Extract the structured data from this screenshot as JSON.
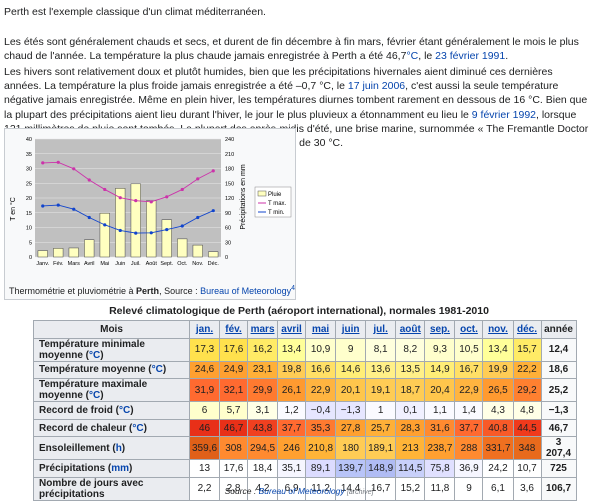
{
  "intro": {
    "p1": "Perth est l'exemple classique d'un climat méditerranéen.",
    "p2_a": "Les étés sont généralement chauds et secs, et durent de fin décembre à fin mars, février étant généralement le mois le plus chaud de l'année. La température la plus chaude jamais enregistrée à Perth a été 46,7",
    "p2_unit": "°C",
    "p2_b": ", le ",
    "p2_date": "23 février 1991",
    "p2_end": ".",
    "p3_a": "Les hivers sont relativement doux et plutôt humides, bien que les précipitations hivernales aient diminué ces dernières années. La température la plus froide jamais enregistrée a été –0,7 °C, le ",
    "p3_date1": "17 juin 2006",
    "p3_b": ", c'est aussi la seule température négative jamais enregistrée. Même en plein hiver, les températures diurnes tombent rarement en dessous de 16 °C. Bien que la plupart des précipitations aient lieu durant l'hiver, le jour le plus pluvieux a étonnamment eu lieu le ",
    "p3_date2": "9 février 1992",
    "p3_c": ", lorsque 121 millimètres de pluie sont tombés. La plupart des après-midis d'été, une brise marine, surnommée « The Fremantle Doctor », souffle du sud-ouest, refroidissant la ville parfois en dessous de 30 °C."
  },
  "chart_data": {
    "type": "bar",
    "categories": [
      "Janv.",
      "Fév.",
      "Mars",
      "Avril",
      "Mai",
      "Juin",
      "Juil.",
      "Août",
      "Sept.",
      "Oct.",
      "Nov.",
      "Déc."
    ],
    "ylabel_left": "T en °C",
    "ylabel_right": "Précipitations en mm",
    "ylim_left": [
      0,
      40
    ],
    "ylim_right": [
      0,
      240
    ],
    "yticks_left": [
      "0",
      "5",
      "10",
      "15",
      "20",
      "25",
      "30",
      "35",
      "40"
    ],
    "yticks_right": [
      "0",
      "30",
      "60",
      "90",
      "120",
      "150",
      "180",
      "210",
      "240"
    ],
    "legend": [
      "Pluie",
      "T max.",
      "T min."
    ],
    "legend_position": "right",
    "series": [
      {
        "name": "Pluie",
        "axis": "right",
        "kind": "bar",
        "color": "#ffffc0",
        "values": [
          13,
          17.6,
          18.4,
          35.1,
          89.1,
          139.7,
          148.9,
          114.5,
          75.8,
          36.9,
          24.2,
          10.7
        ]
      },
      {
        "name": "T max.",
        "axis": "left",
        "kind": "line",
        "color": "#cc33aa",
        "values": [
          31.9,
          32.1,
          29.9,
          26.1,
          22.9,
          20.1,
          19.1,
          18.7,
          20.4,
          22.9,
          26.5,
          29.2
        ]
      },
      {
        "name": "T min.",
        "axis": "left",
        "kind": "line",
        "color": "#1144cc",
        "values": [
          17.3,
          17.6,
          16.2,
          13.4,
          10.9,
          9,
          8.1,
          8.2,
          9.3,
          10.5,
          13.4,
          15.7
        ]
      }
    ]
  },
  "caption": {
    "text_a": "Thermométrie et pluviométrie à ",
    "city": "Perth",
    "text_b": ", Source : ",
    "source": "Bureau of Meteorology",
    "sup": "4"
  },
  "table": {
    "title": "Relevé climatologique de Perth (aéroport international), normales 1981-2010",
    "header_first": "Mois",
    "months": [
      "jan.",
      "fév.",
      "mars",
      "avril",
      "mai",
      "juin",
      "jul.",
      "août",
      "sep.",
      "oct.",
      "nov.",
      "déc."
    ],
    "header_year": "année",
    "rows": [
      {
        "label": "Température minimale moyenne",
        "unit": "°C",
        "cells": [
          "17,3",
          "17,6",
          "16,2",
          "13,4",
          "10,9",
          "9",
          "8,1",
          "8,2",
          "9,3",
          "10,5",
          "13,4",
          "15,7"
        ],
        "year": "12,4",
        "colors": [
          "#ffe14d",
          "#ffe14d",
          "#ffeb66",
          "#ffff99",
          "#ffffcc",
          "#ffffcc",
          "#ffffdd",
          "#ffffdd",
          "#ffffcc",
          "#ffffcc",
          "#ffff99",
          "#ffeb66"
        ]
      },
      {
        "label": "Température moyenne",
        "unit": "°C",
        "cells": [
          "24,6",
          "24,9",
          "23,1",
          "19,8",
          "16,6",
          "14,6",
          "13,6",
          "13,5",
          "14,9",
          "16,7",
          "19,9",
          "22,2"
        ],
        "year": "18,6",
        "colors": [
          "#ffa030",
          "#ffa030",
          "#ffb038",
          "#ffcc55",
          "#ffe066",
          "#ffee77",
          "#fff088",
          "#fff088",
          "#ffee77",
          "#ffe066",
          "#ffcc55",
          "#ffb038"
        ]
      },
      {
        "label": "Température maximale moyenne",
        "unit": "°C",
        "cells": [
          "31,9",
          "32,1",
          "29,9",
          "26,1",
          "22,9",
          "20,1",
          "19,1",
          "18,7",
          "20,4",
          "22,9",
          "26,5",
          "29,2"
        ],
        "year": "25,2",
        "colors": [
          "#ff6a30",
          "#ff6a30",
          "#ff7a30",
          "#ff9a30",
          "#ffb440",
          "#ffc64c",
          "#ffcc55",
          "#ffcc55",
          "#ffc64c",
          "#ffb440",
          "#ff9a30",
          "#ff8030"
        ]
      },
      {
        "label": "Record de froid",
        "unit": "°C",
        "cells": [
          "6",
          "5,7",
          "3,1",
          "1,2",
          "−0,4",
          "−1,3",
          "1",
          "0,1",
          "1,1",
          "1,4",
          "4,3",
          "4,8"
        ],
        "year": "−1,3",
        "colors": [
          "#ffffcc",
          "#ffffcc",
          "#ffffe6",
          "#fafaff",
          "#e6e6ff",
          "#e6e6ff",
          "#fafaff",
          "#f0f0ff",
          "#fafaff",
          "#fafaff",
          "#ffffe6",
          "#ffffe6"
        ]
      },
      {
        "label": "Record de chaleur",
        "unit": "°C",
        "cells": [
          "46",
          "46,7",
          "43,8",
          "37,7",
          "35,3",
          "27,8",
          "25,7",
          "28,3",
          "31,6",
          "37,7",
          "40,8",
          "44,5"
        ],
        "year": "46,7",
        "colors": [
          "#e83018",
          "#e83018",
          "#f04020",
          "#ff6a30",
          "#ff7a30",
          "#ffa030",
          "#ffb038",
          "#ffa030",
          "#ff8a30",
          "#ff6a30",
          "#f85a28",
          "#f03a1c"
        ]
      },
      {
        "label": "Ensoleillement",
        "unit": "h",
        "cells": [
          "359,6",
          "308",
          "294,5",
          "246",
          "210,8",
          "180",
          "189,1",
          "213",
          "238,7",
          "288",
          "331,7",
          "348"
        ],
        "year": "3 207,4",
        "colors": [
          "#e06018",
          "#ff8a30",
          "#ff8a30",
          "#ffa030",
          "#ffb438",
          "#ffcc55",
          "#ffcc55",
          "#ffb438",
          "#ffa030",
          "#ff8a30",
          "#f07020",
          "#e86a1c"
        ]
      },
      {
        "label": "Précipitations",
        "unit": "mm",
        "cells": [
          "13",
          "17,6",
          "18,4",
          "35,1",
          "89,1",
          "139,7",
          "148,9",
          "114,5",
          "75,8",
          "36,9",
          "24,2",
          "10,7"
        ],
        "year": "725",
        "colors": [
          "#ffffff",
          "#ffffff",
          "#ffffff",
          "#f6f6ff",
          "#dcdcff",
          "#b8c4f8",
          "#b0bcf4",
          "#c8d0fa",
          "#e0e0ff",
          "#f6f6ff",
          "#ffffff",
          "#ffffff"
        ]
      },
      {
        "label": "Nombre de jours avec précipitations",
        "unit": "",
        "cells": [
          "2,2",
          "2,8",
          "4,2",
          "6,9",
          "11,2",
          "14,4",
          "16,7",
          "15,2",
          "11,8",
          "9",
          "6,1",
          "3,6"
        ],
        "year": "106,7",
        "colors": [
          "#ffffff",
          "#ffffff",
          "#ffffff",
          "#ffffff",
          "#ffffff",
          "#ffffff",
          "#ffffff",
          "#ffffff",
          "#ffffff",
          "#ffffff",
          "#ffffff",
          "#ffffff"
        ]
      }
    ],
    "source_label": "Source : ",
    "source_link": "Bureau of Meteorology",
    "archive": "[archive]"
  }
}
